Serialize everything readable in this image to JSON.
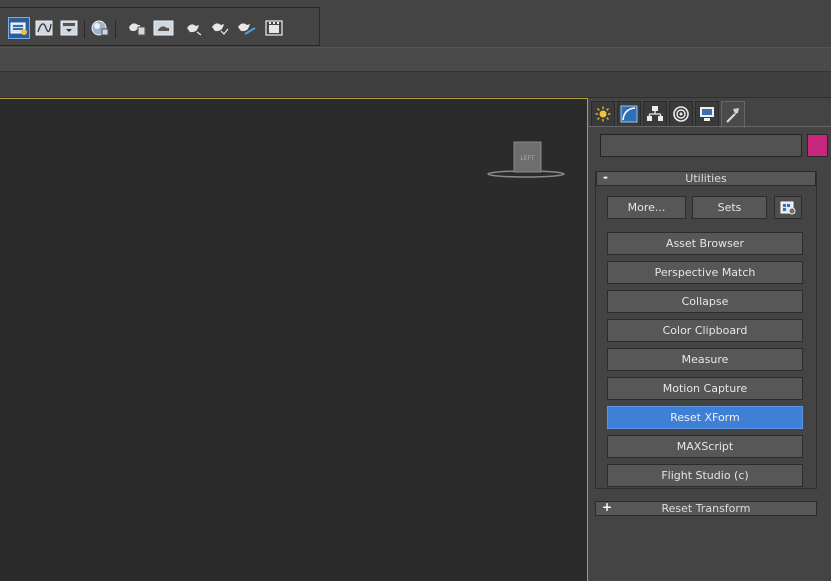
{
  "toolbar": {
    "buttons": [
      {
        "icon": "layer-explorer-icon",
        "active": true
      },
      {
        "icon": "curve-editor-icon"
      },
      {
        "icon": "toggle-ribbon-icon"
      },
      {
        "icon": "material-editor-icon"
      },
      {
        "icon": "render-setup-icon"
      },
      {
        "icon": "rendered-frame-window-icon"
      },
      {
        "icon": "render-teapot-icon"
      },
      {
        "icon": "render-iterative-icon"
      },
      {
        "icon": "render-activeshade-icon"
      },
      {
        "icon": "render-frame-icon"
      }
    ]
  },
  "viewport": {
    "viewcube_label": "LEFT"
  },
  "command_panel": {
    "tabs": [
      {
        "icon": "create-tab-icon"
      },
      {
        "icon": "modify-tab-icon"
      },
      {
        "icon": "hierarchy-tab-icon"
      },
      {
        "icon": "motion-tab-icon"
      },
      {
        "icon": "display-tab-icon"
      },
      {
        "icon": "utilities-tab-icon",
        "active": true
      }
    ],
    "name_value": "",
    "color": "#c8267f",
    "utilities": {
      "toggle": "-",
      "title": "Utilities",
      "more_label": "More...",
      "sets_label": "Sets",
      "configure_icon": "configure-button-sets-icon",
      "items": [
        "Asset Browser",
        "Perspective Match",
        "Collapse",
        "Color Clipboard",
        "Measure",
        "Motion Capture",
        "Reset XForm",
        "MAXScript",
        "Flight Studio (c)"
      ],
      "selected_item": "Reset XForm"
    },
    "reset_transform": {
      "toggle": "+",
      "title": "Reset Transform"
    }
  }
}
